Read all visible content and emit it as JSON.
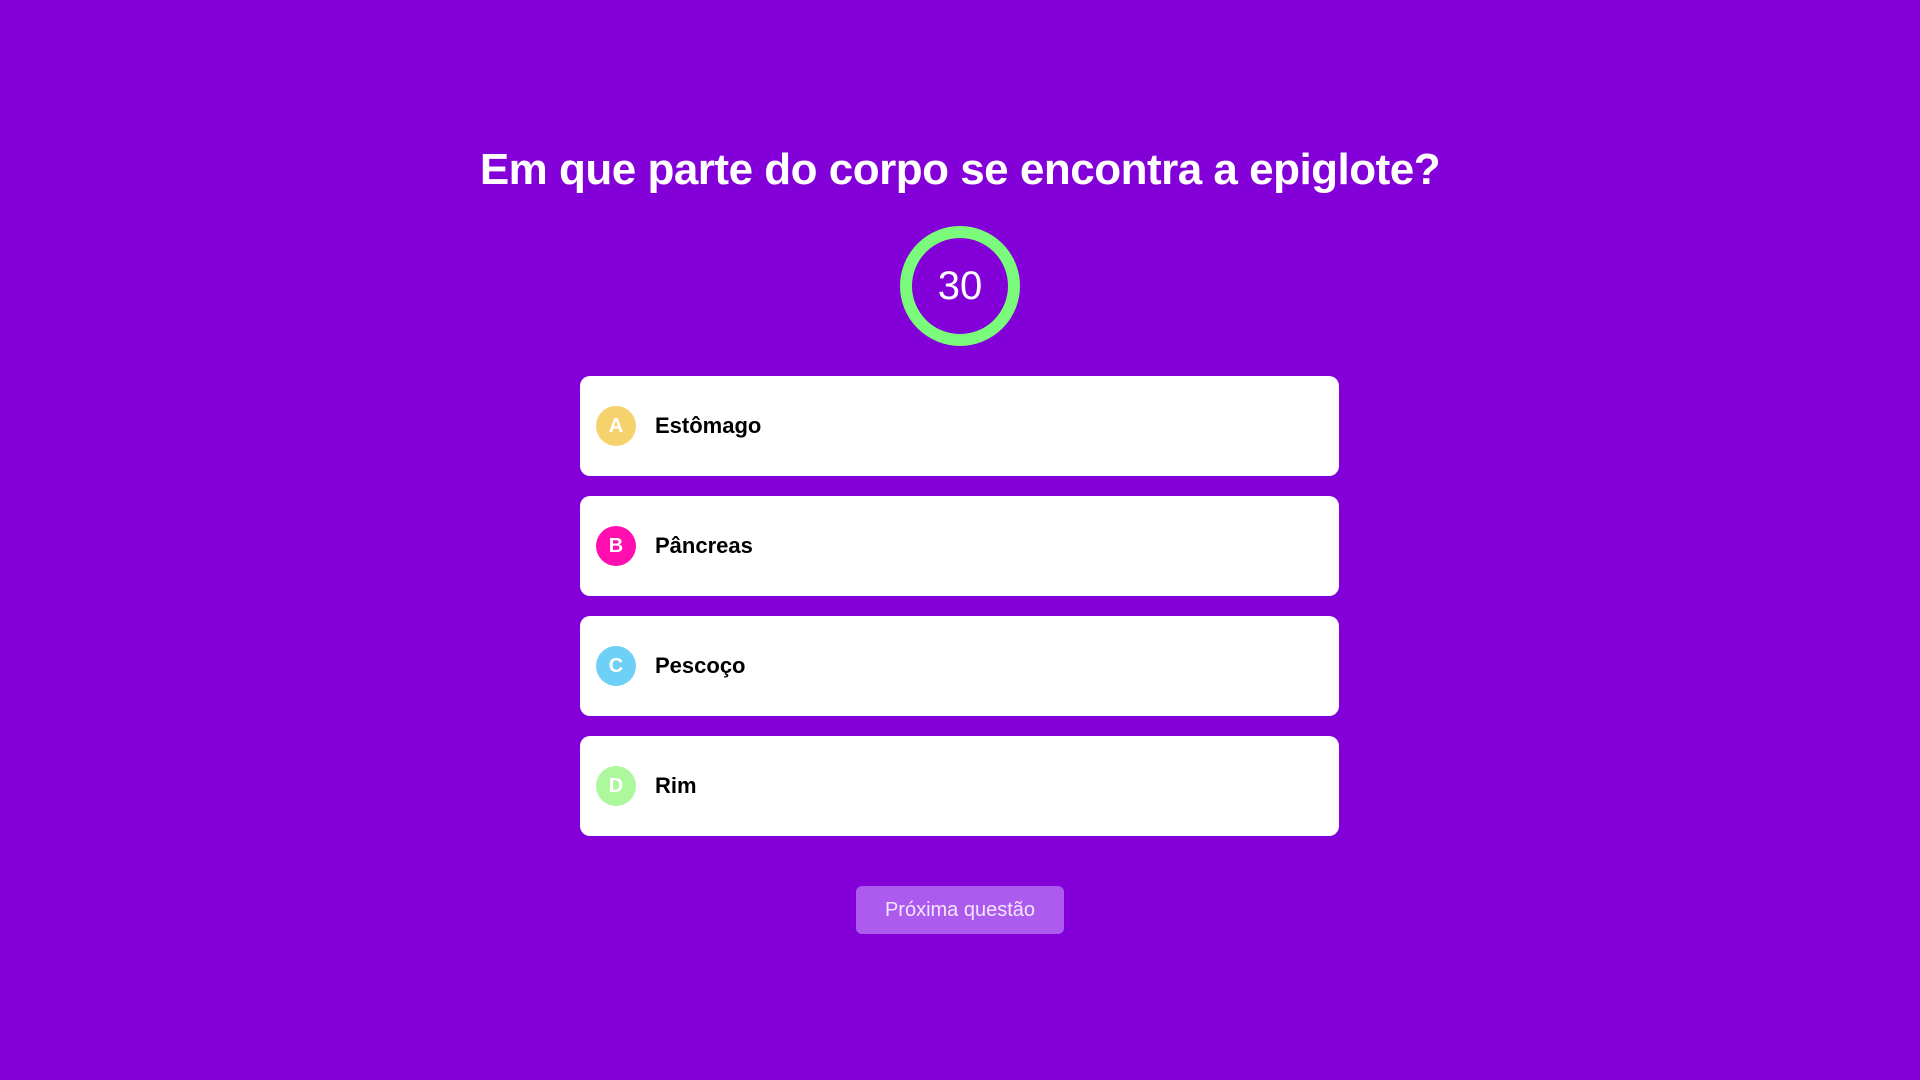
{
  "question": "Em que parte do corpo se encontra a epiglote?",
  "timer": {
    "value": "30",
    "ring_color": "#7bfb7b"
  },
  "answers": [
    {
      "letter": "A",
      "label": "Estômago",
      "color": "#f5d26b"
    },
    {
      "letter": "B",
      "label": "Pâncreas",
      "color": "#ff0eb0"
    },
    {
      "letter": "C",
      "label": "Pescoço",
      "color": "#6fd0f5"
    },
    {
      "letter": "D",
      "label": "Rim",
      "color": "#adf79c"
    }
  ],
  "next_button": {
    "label": "Próxima questão"
  },
  "colors": {
    "background": "#8400d8",
    "button": "#ad5aee"
  }
}
